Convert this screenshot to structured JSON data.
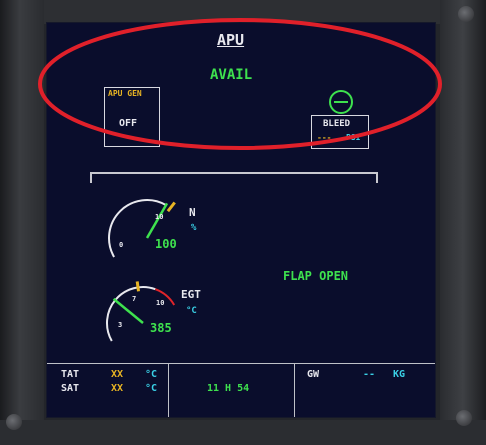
{
  "page": {
    "title": "APU",
    "status": "AVAIL",
    "flap_status": "FLAP OPEN"
  },
  "apu_gen": {
    "label": "APU GEN",
    "state": "OFF"
  },
  "bleed": {
    "label": "BLEED",
    "value": "---",
    "unit": "PSI"
  },
  "n_gauge": {
    "label": "N",
    "unit": "%",
    "value_text": "100",
    "value": 100,
    "scale_min": 0,
    "scale_max": 100,
    "scale_labels": [
      "0",
      "10"
    ]
  },
  "egt_gauge": {
    "label": "EGT",
    "unit": "°C",
    "value_text": "385",
    "value": 385,
    "scale_min": 0,
    "scale_max": 1000,
    "scale_labels": [
      "3",
      "7",
      "10"
    ]
  },
  "bottom": {
    "tat_label": "TAT",
    "tat_value": "XX",
    "tat_unit": "°C",
    "sat_label": "SAT",
    "sat_value": "XX",
    "sat_unit": "°C",
    "time": "11 H 54",
    "gw_label": "GW",
    "gw_value": "--",
    "gw_unit": "KG"
  },
  "colors": {
    "green": "#3ee14e",
    "cyan": "#3ad0e6",
    "amber": "#e8b423",
    "red": "#e0242a",
    "white": "#e8e8ee"
  }
}
